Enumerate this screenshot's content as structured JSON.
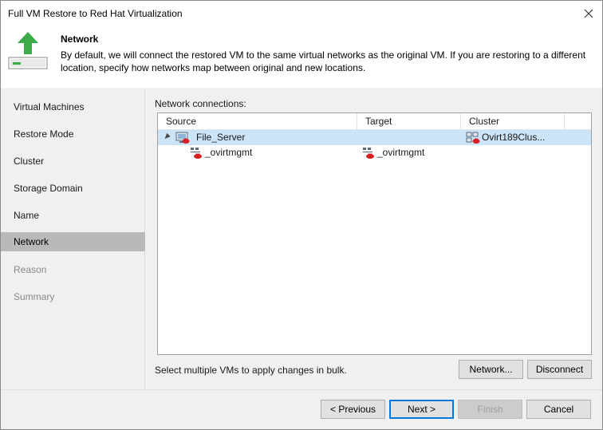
{
  "window": {
    "title": "Full VM Restore to Red Hat Virtualization"
  },
  "header": {
    "title": "Network",
    "description": "By default, we will connect the restored VM to the same virtual networks as the original VM. If you are restoring to a different location, specify how networks map between original and new locations."
  },
  "steps": [
    {
      "label": "Virtual Machines",
      "state": "normal"
    },
    {
      "label": "Restore Mode",
      "state": "normal"
    },
    {
      "label": "Cluster",
      "state": "normal"
    },
    {
      "label": "Storage Domain",
      "state": "normal"
    },
    {
      "label": "Name",
      "state": "normal"
    },
    {
      "label": "Network",
      "state": "active"
    },
    {
      "label": "Reason",
      "state": "disabled"
    },
    {
      "label": "Summary",
      "state": "disabled"
    }
  ],
  "content": {
    "connections_label": "Network connections:",
    "columns": [
      "Source",
      "Target",
      "Cluster"
    ],
    "rows": [
      {
        "source": "File_Server",
        "target": "",
        "cluster": "Ovirt189Clus...",
        "icon": "vm-icon",
        "expanded": true,
        "selected": true
      },
      {
        "source": "_ovirtmgmt",
        "target": "_ovirtmgmt",
        "cluster": "",
        "icon": "network-icon",
        "selected": false
      }
    ],
    "bulk_hint": "Select multiple VMs to apply changes in bulk.",
    "network_button": "Network...",
    "disconnect_button": "Disconnect"
  },
  "footer": {
    "previous": "< Previous",
    "next": "Next >",
    "finish": "Finish",
    "cancel": "Cancel"
  },
  "colors": {
    "accent": "#0078d7",
    "selected_row": "#cce4f7",
    "active_step": "#b9b9b9",
    "panel": "#f0f0f0"
  }
}
